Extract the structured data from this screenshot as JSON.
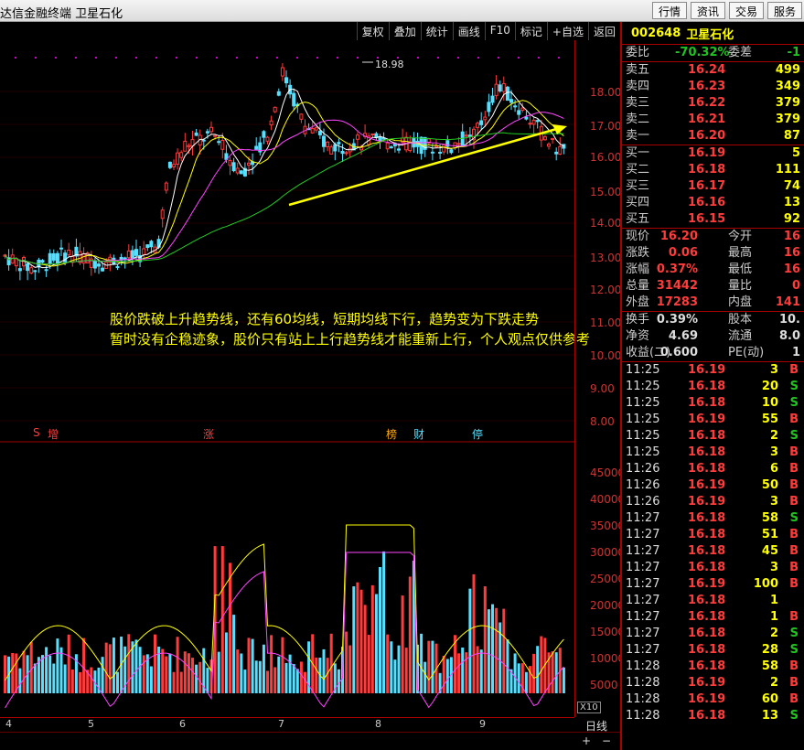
{
  "app_title": "达信金融终端  卫星石化",
  "top_buttons": [
    "行情",
    "资讯",
    "交易",
    "服务"
  ],
  "toolbar": [
    "复权",
    "叠加",
    "统计",
    "画线",
    "F10",
    "标记",
    "+自选",
    "返回"
  ],
  "price_axis": [
    "18.00",
    "17.00",
    "16.00",
    "15.00",
    "14.00",
    "13.00",
    "12.00",
    "11.00",
    "10.00",
    "9.00",
    "8.00"
  ],
  "vol_axis": [
    "45000",
    "40000",
    "35000",
    "30000",
    "25000",
    "20000",
    "15000",
    "10000",
    "5000"
  ],
  "vol_unit": "X10",
  "x_labels": [
    "4",
    "5",
    "6",
    "7",
    "8",
    "9"
  ],
  "period": "日线",
  "peak_label": "18.98",
  "annotation": {
    "line1": "股价跌破上升趋势线，还有60均线，短期均线下行，趋势变为下跌走势",
    "line2": "暂时没有企稳迹象，股价只有站上上行趋势线才能重新上行，个人观点仅供参考"
  },
  "event_tags": [
    {
      "text": "S",
      "color": "#ff3b3b"
    },
    {
      "text": "增",
      "color": "#ff3b3b"
    },
    {
      "text": "涨",
      "color": "#ff3b3b"
    },
    {
      "text": "榜",
      "color": "#ffaa00"
    },
    {
      "text": "财",
      "color": "#55e0ff"
    },
    {
      "text": "停",
      "color": "#55e0ff"
    }
  ],
  "quote": {
    "code": "002648",
    "name": "卫星石化",
    "wei_bi_label": "委比",
    "wei_bi": "-70.32%",
    "wei_cha_label": "委差",
    "wei_cha": "-1",
    "asks": [
      {
        "label": "卖五",
        "price": "16.24",
        "vol": "499"
      },
      {
        "label": "卖四",
        "price": "16.23",
        "vol": "349"
      },
      {
        "label": "卖三",
        "price": "16.22",
        "vol": "379"
      },
      {
        "label": "卖二",
        "price": "16.21",
        "vol": "379"
      },
      {
        "label": "卖一",
        "price": "16.20",
        "vol": "87"
      }
    ],
    "bids": [
      {
        "label": "买一",
        "price": "16.19",
        "vol": "5"
      },
      {
        "label": "买二",
        "price": "16.18",
        "vol": "111"
      },
      {
        "label": "买三",
        "price": "16.17",
        "vol": "74"
      },
      {
        "label": "买四",
        "price": "16.16",
        "vol": "13"
      },
      {
        "label": "买五",
        "price": "16.15",
        "vol": "92"
      }
    ],
    "stats": [
      {
        "l1": "现价",
        "v1": "16.20",
        "l2": "今开",
        "v2": "16"
      },
      {
        "l1": "涨跌",
        "v1": "0.06",
        "l2": "最高",
        "v2": "16"
      },
      {
        "l1": "涨幅",
        "v1": "0.37%",
        "l2": "最低",
        "v2": "16"
      },
      {
        "l1": "总量",
        "v1": "31442",
        "l2": "量比",
        "v2": "0"
      },
      {
        "l1": "外盘",
        "v1": "17283",
        "l2": "内盘",
        "v2": "141"
      }
    ],
    "stats2": [
      {
        "l1": "换手",
        "v1": "0.39%",
        "l2": "股本",
        "v2": "10."
      },
      {
        "l1": "净资",
        "v1": "4.69",
        "l2": "流通",
        "v2": "8.0"
      },
      {
        "l1": "收益(二)",
        "v1": "0.600",
        "l2": "PE(动)",
        "v2": "1"
      }
    ]
  },
  "trades": [
    {
      "t": "11:25",
      "p": "16.19",
      "q": "3",
      "s": "B"
    },
    {
      "t": "11:25",
      "p": "16.18",
      "q": "20",
      "s": "S"
    },
    {
      "t": "11:25",
      "p": "16.18",
      "q": "10",
      "s": "S"
    },
    {
      "t": "11:25",
      "p": "16.19",
      "q": "55",
      "s": "B"
    },
    {
      "t": "11:25",
      "p": "16.18",
      "q": "2",
      "s": "S"
    },
    {
      "t": "11:25",
      "p": "16.18",
      "q": "3",
      "s": "B"
    },
    {
      "t": "11:26",
      "p": "16.18",
      "q": "6",
      "s": "B"
    },
    {
      "t": "11:26",
      "p": "16.19",
      "q": "50",
      "s": "B"
    },
    {
      "t": "11:26",
      "p": "16.19",
      "q": "3",
      "s": "B"
    },
    {
      "t": "11:27",
      "p": "16.18",
      "q": "58",
      "s": "S"
    },
    {
      "t": "11:27",
      "p": "16.18",
      "q": "51",
      "s": "B"
    },
    {
      "t": "11:27",
      "p": "16.18",
      "q": "45",
      "s": "B"
    },
    {
      "t": "11:27",
      "p": "16.18",
      "q": "3",
      "s": "B"
    },
    {
      "t": "11:27",
      "p": "16.19",
      "q": "100",
      "s": "B"
    },
    {
      "t": "11:27",
      "p": "16.18",
      "q": "1",
      "s": ""
    },
    {
      "t": "11:27",
      "p": "16.18",
      "q": "1",
      "s": "B"
    },
    {
      "t": "11:27",
      "p": "16.18",
      "q": "2",
      "s": "S"
    },
    {
      "t": "11:27",
      "p": "16.18",
      "q": "28",
      "s": "S"
    },
    {
      "t": "11:28",
      "p": "16.18",
      "q": "58",
      "s": "B"
    },
    {
      "t": "11:28",
      "p": "16.19",
      "q": "2",
      "s": "B"
    },
    {
      "t": "11:28",
      "p": "16.19",
      "q": "60",
      "s": "B"
    },
    {
      "t": "11:28",
      "p": "16.18",
      "q": "13",
      "s": "S"
    }
  ],
  "colors": {
    "up": "#ff3b3b",
    "down": "#55e0ff",
    "ma5": "#ffffff",
    "ma10": "#ffff00",
    "ma20": "#ff44ff",
    "ma60": "#22cc22",
    "trend": "#ffff00"
  }
}
